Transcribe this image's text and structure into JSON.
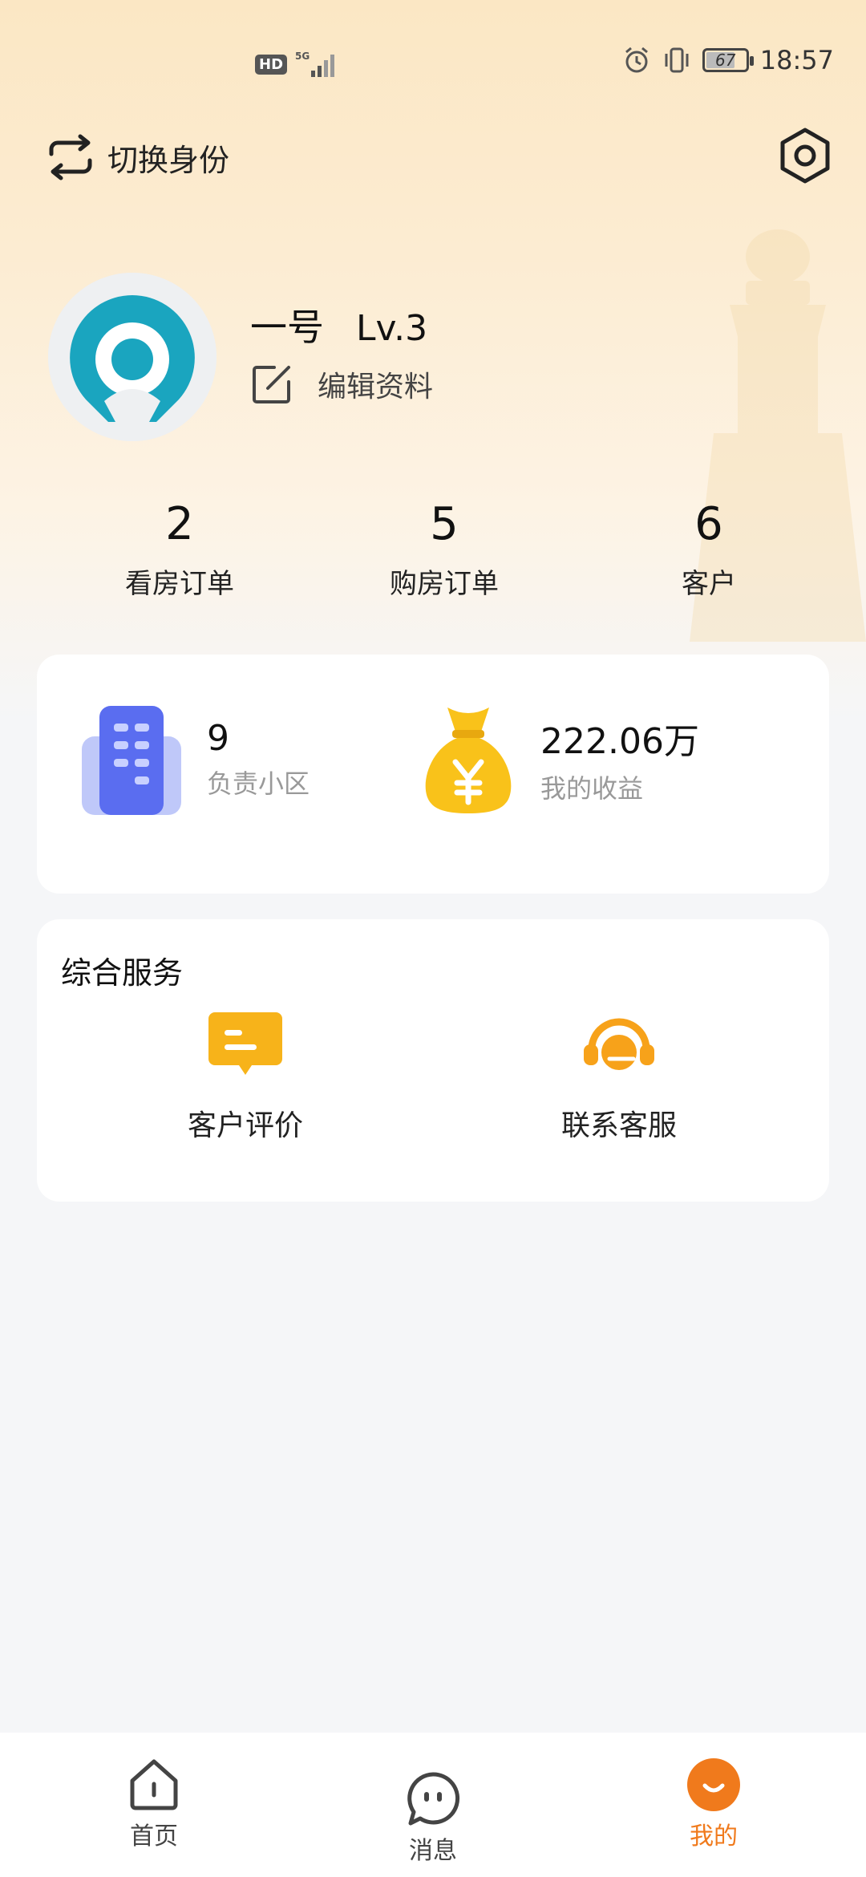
{
  "status_bar": {
    "network_badge": "HD",
    "network_type": "5G",
    "battery_level": "67",
    "time": "18:57"
  },
  "header": {
    "switch_identity_label": "切换身份"
  },
  "profile": {
    "username": "一号",
    "level": "Lv.3",
    "edit_label": "编辑资料"
  },
  "stats": [
    {
      "value": "2",
      "label": "看房订单"
    },
    {
      "value": "5",
      "label": "购房订单"
    },
    {
      "value": "6",
      "label": "客户"
    }
  ],
  "summary": {
    "communities": {
      "value": "9",
      "label": "负责小区"
    },
    "earnings": {
      "value": "222.06万",
      "label": "我的收益"
    }
  },
  "services": {
    "title": "综合服务",
    "items": [
      {
        "label": "客户评价"
      },
      {
        "label": "联系客服"
      }
    ]
  },
  "bottom_nav": {
    "items": [
      {
        "label": "首页"
      },
      {
        "label": "消息"
      },
      {
        "label": "我的"
      }
    ],
    "active_color": "#f07a1c"
  },
  "colors": {
    "accent": "#f07a1c",
    "gold": "#f9c21a",
    "building_blue": "#5a6df0",
    "avatar_teal": "#1aa5bf"
  }
}
